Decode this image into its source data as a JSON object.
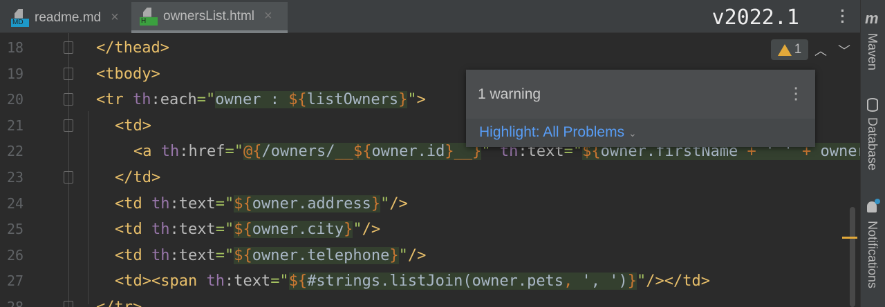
{
  "tabs": [
    {
      "label": "readme.md",
      "icon": "markdown-file-icon",
      "badge": "MD",
      "badge_color": "#1d99c9"
    },
    {
      "label": "ownersList.html",
      "icon": "html-file-icon",
      "badge": "H",
      "badge_color": "#3ba03f"
    }
  ],
  "version": "v2022.1",
  "inspection": {
    "warning_count": "1"
  },
  "popup": {
    "title": "1 warning",
    "highlight": "Highlight: All Problems"
  },
  "sidebar": {
    "maven_logo": "m",
    "maven": "Maven",
    "database": "Database",
    "notifications": "Notifications"
  },
  "lines": [
    {
      "n": "18",
      "indent": 0,
      "t": [
        [
          "tag",
          "</thead>"
        ]
      ]
    },
    {
      "n": "19",
      "indent": 0,
      "t": [
        [
          "tag",
          "<tbody>"
        ]
      ]
    },
    {
      "n": "20",
      "indent": 0,
      "t": [
        [
          "tag",
          "<tr "
        ],
        [
          "ns",
          "th"
        ],
        [
          "attr",
          ":each"
        ],
        [
          "q",
          "=\""
        ],
        [
          "ex",
          "owner : "
        ],
        [
          "dl",
          "${"
        ],
        [
          "ex",
          "listOwners"
        ],
        [
          "dl",
          "}"
        ],
        [
          "q",
          "\""
        ],
        [
          "tag",
          ">"
        ]
      ]
    },
    {
      "n": "21",
      "indent": 1,
      "t": [
        [
          "tag",
          "<td>"
        ]
      ]
    },
    {
      "n": "22",
      "indent": 2,
      "t": [
        [
          "tag",
          "<a "
        ],
        [
          "ns",
          "th"
        ],
        [
          "attr",
          ":href"
        ],
        [
          "q",
          "=\""
        ],
        [
          "dl",
          "@{"
        ],
        [
          "ex",
          "/owners/"
        ],
        [
          "dl",
          "__${"
        ],
        [
          "ex",
          "owner.id"
        ],
        [
          "dl",
          "}__}"
        ],
        [
          "q",
          "\" "
        ],
        [
          "ns",
          "th"
        ],
        [
          "attr",
          ":text"
        ],
        [
          "q",
          "=\""
        ],
        [
          "dl",
          "${"
        ],
        [
          "ex",
          "owner.firstName "
        ],
        [
          "dl",
          "+"
        ],
        [
          "ex",
          " ' ' "
        ],
        [
          "dl",
          "+"
        ],
        [
          "ex",
          " owner.lastName"
        ]
      ]
    },
    {
      "n": "23",
      "indent": 1,
      "t": [
        [
          "tag",
          "</td>"
        ]
      ]
    },
    {
      "n": "24",
      "indent": 1,
      "t": [
        [
          "tag",
          "<td "
        ],
        [
          "ns",
          "th"
        ],
        [
          "attr",
          ":text"
        ],
        [
          "q",
          "=\""
        ],
        [
          "dl",
          "${"
        ],
        [
          "ex",
          "owner.address"
        ],
        [
          "dl",
          "}"
        ],
        [
          "q",
          "\""
        ],
        [
          "tag",
          "/>"
        ]
      ]
    },
    {
      "n": "25",
      "indent": 1,
      "t": [
        [
          "tag",
          "<td "
        ],
        [
          "ns",
          "th"
        ],
        [
          "attr",
          ":text"
        ],
        [
          "q",
          "=\""
        ],
        [
          "dl",
          "${"
        ],
        [
          "ex",
          "owner.city"
        ],
        [
          "dl",
          "}"
        ],
        [
          "q",
          "\""
        ],
        [
          "tag",
          "/>"
        ]
      ]
    },
    {
      "n": "26",
      "indent": 1,
      "t": [
        [
          "tag",
          "<td "
        ],
        [
          "ns",
          "th"
        ],
        [
          "attr",
          ":text"
        ],
        [
          "q",
          "=\""
        ],
        [
          "dl",
          "${"
        ],
        [
          "ex",
          "owner.telephone"
        ],
        [
          "dl",
          "}"
        ],
        [
          "q",
          "\""
        ],
        [
          "tag",
          "/>"
        ]
      ]
    },
    {
      "n": "27",
      "indent": 1,
      "t": [
        [
          "tag",
          "<td><span "
        ],
        [
          "ns",
          "th"
        ],
        [
          "attr",
          ":text"
        ],
        [
          "q",
          "=\""
        ],
        [
          "dl",
          "${"
        ],
        [
          "ex",
          "#strings.listJoin(owner.pets"
        ],
        [
          "dl",
          ","
        ],
        [
          "ex",
          " ', '"
        ],
        [
          "ex",
          ")"
        ],
        [
          "dl",
          "}"
        ],
        [
          "q",
          "\""
        ],
        [
          "tag",
          "/></td>"
        ]
      ]
    },
    {
      "n": "28",
      "indent": 0,
      "t": [
        [
          "tag",
          "</tr>"
        ]
      ]
    }
  ]
}
